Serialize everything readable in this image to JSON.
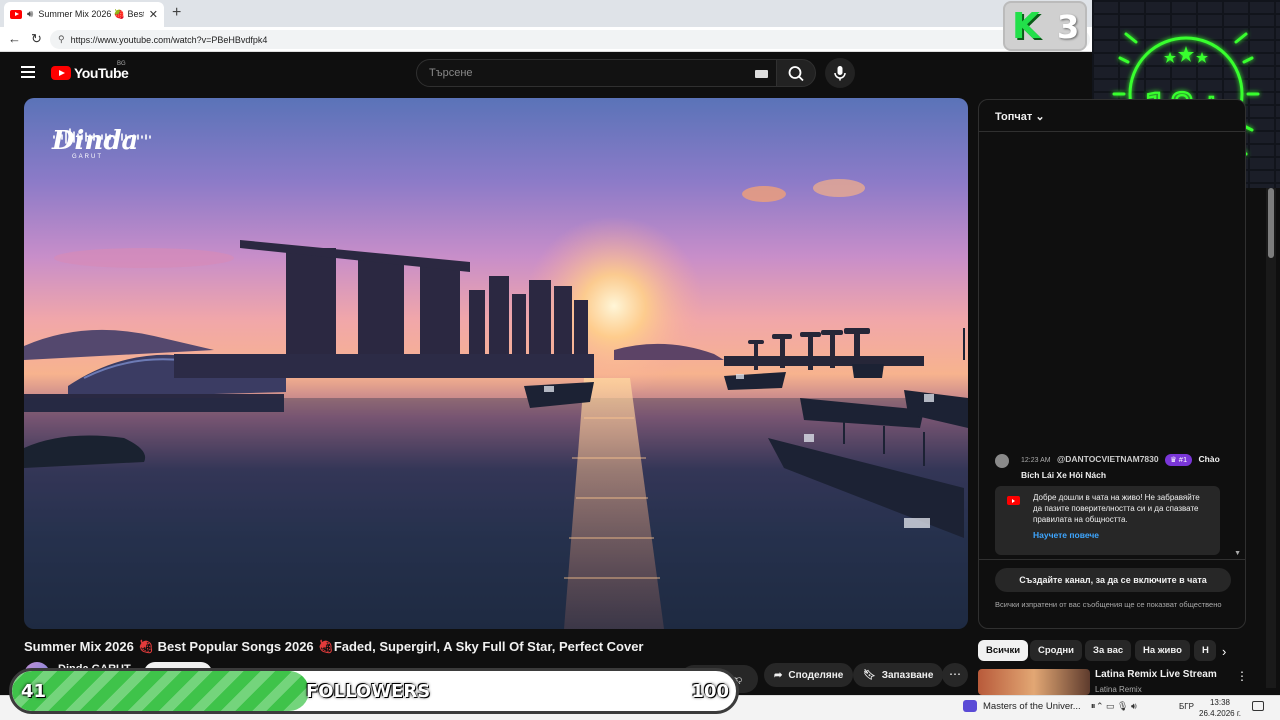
{
  "browser": {
    "tab_title": "Summer Mix 2026 🍓 Best Po",
    "url": "https://www.youtube.com/watch?v=PBeHBvdfpk4"
  },
  "overlay": {
    "k3_letter": "K",
    "k3_digit": "3",
    "age_badge": "18+"
  },
  "header": {
    "logo_text": "YouTube",
    "country_code": "BG",
    "search_placeholder": "Търсене"
  },
  "video": {
    "watermark_name": "Dinda",
    "watermark_sub": "GARUT",
    "title_part1": "Summer Mix 2026",
    "title_part2": "Best Popular Songs 2026",
    "title_part3": "Faded, Supergirl, A Sky Full Of Star, Perfect Cover",
    "channel_name": "Dinda GARUT",
    "like_count": "2",
    "share_label": "Споделяне",
    "save_label": "Запазване"
  },
  "chat": {
    "header_label": "Топчат",
    "message": {
      "time": "12:23 AM",
      "author": "@DANTOCVIETNAM7830",
      "rank": "#1",
      "text": "Chào Bích Lái Xe Hôi Nách"
    },
    "welcome_text": "Добре дошли в чата на живо! Не забравяйте да пазите поверителността си и да спазвате правилата на общността.",
    "learn_more": "Научете повече",
    "join_button": "Създайте канал, за да се включите в чата",
    "note": "Всички изпратени от вас съобщения ще се показват обществено"
  },
  "chips": [
    "Всички",
    "Сродни",
    "За вас",
    "На живо",
    "Н"
  ],
  "recommended": {
    "title": "Latina Remix Live Stream",
    "channel": "Latina Remix"
  },
  "followers": {
    "current": "41",
    "label": "FOLLOWERS",
    "goal": "100",
    "progress": 0.41
  },
  "taskbar": {
    "media_title": "Masters of the Univer...",
    "language": "БГР",
    "time": "13:38",
    "date": "26.4.2026 г."
  },
  "colors": {
    "youtube_red": "#ff0000",
    "progress_green": "#3fc34a",
    "neon_green": "#39ff2e",
    "link_blue": "#3ea6ff",
    "rank_purple": "#7a36d8"
  }
}
